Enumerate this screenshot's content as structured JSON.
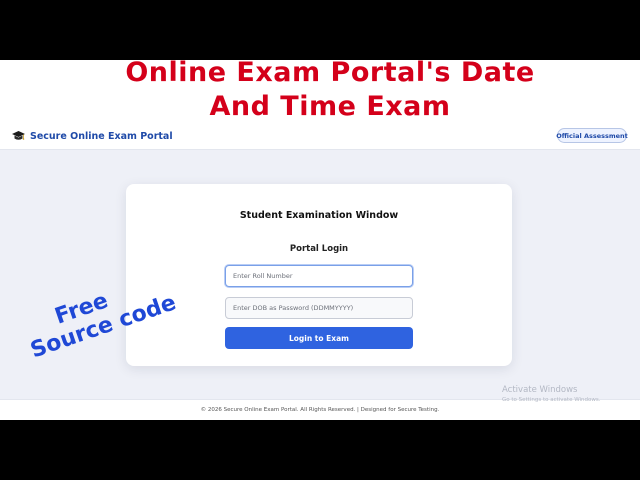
{
  "overlay": {
    "title_line1": "Online Exam Portal's Date",
    "title_line2": "And Time Exam",
    "title_color": "#d4001a",
    "free_line1": "Free",
    "free_line2": "Source code",
    "free_color": "#1f48d6"
  },
  "header": {
    "brand_icon": "graduation-cap-icon",
    "brand_text": "Secure Online Exam Portal",
    "badge_text": "Official Assessment",
    "brand_color": "#1f4aa8"
  },
  "card": {
    "title": "Student Examination Window",
    "subtitle": "Portal Login",
    "roll_input": {
      "value": "",
      "placeholder": "Enter Roll Number"
    },
    "dob_input": {
      "value": "",
      "placeholder": "Enter DOB as Password (DDMMYYYY)"
    },
    "login_label": "Login to Exam",
    "button_color": "#2f63e0"
  },
  "footer": {
    "text": "© 2026 Secure Online Exam Portal. All Rights Reserved. | Designed for Secure Testing."
  },
  "watermark": {
    "line1": "Activate Windows",
    "line2": "Go to Settings to activate Windows."
  }
}
